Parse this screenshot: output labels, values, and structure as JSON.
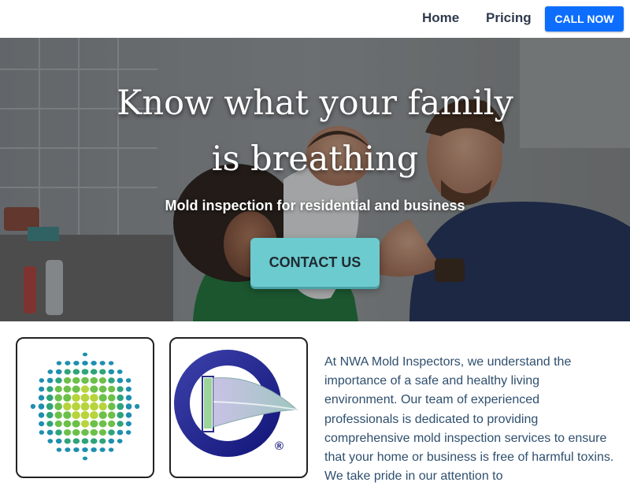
{
  "nav": {
    "home_label": "Home",
    "pricing_label": "Pricing",
    "call_label": "CALL NOW"
  },
  "hero": {
    "title_line1": "Know what your family",
    "title_line2": "is breathing",
    "subtitle": "Mold inspection for residential and business",
    "contact_label": "CONTACT US"
  },
  "logos": {
    "logo1": "dotted-globe-logo-icon",
    "logo2": "certification-flag-logo-icon",
    "registered_mark": "®"
  },
  "intro": {
    "text": "At NWA Mold Inspectors, we understand the importance of a safe and healthy living environment. Our team of experienced professionals is dedicated to providing comprehensive mold inspection services to ensure that your home or business is free of harmful toxins. We take pride in our attention to"
  },
  "colors": {
    "call_button": "#0d6efd",
    "contact_button": "#6ccbcf",
    "intro_text": "#2f4f6e",
    "nav_text": "#2f3b4c"
  }
}
